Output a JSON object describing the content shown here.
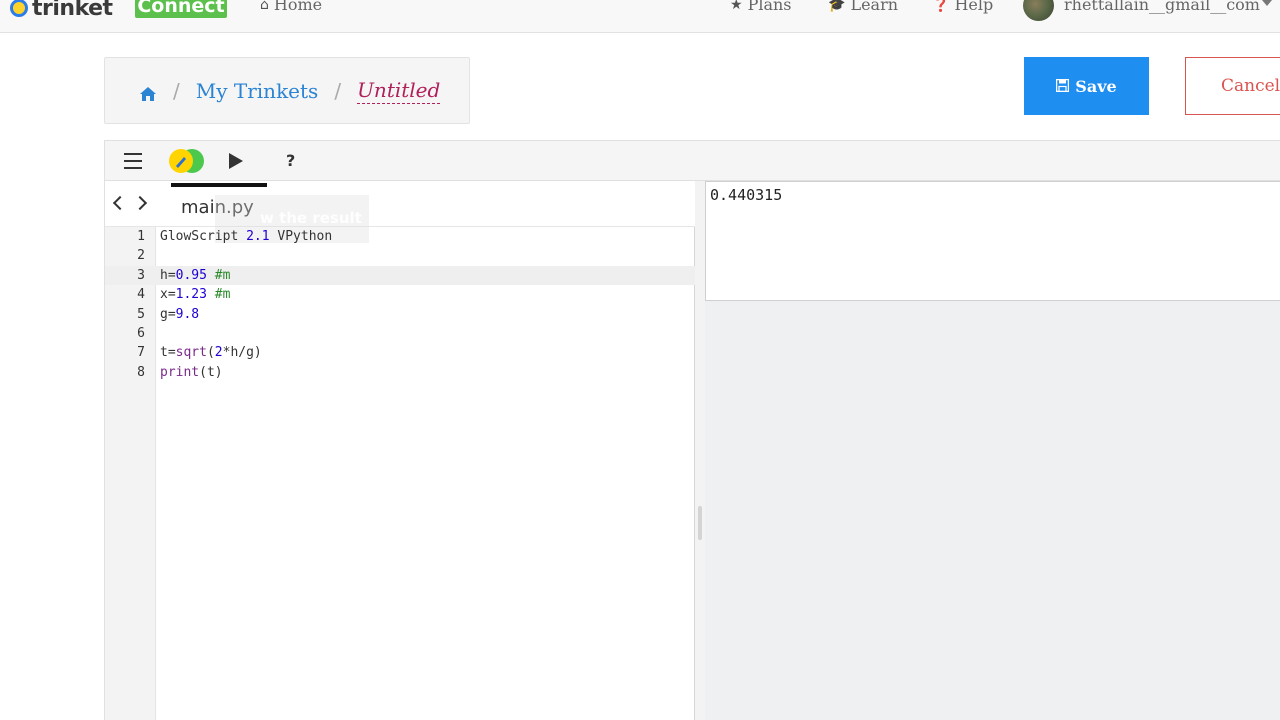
{
  "nav": {
    "logo_text": "trinket",
    "badge_text": "Connect",
    "home_label": "Home",
    "plans_label": "Plans",
    "learn_label": "Learn",
    "help_label": "Help",
    "username": "rhettallain__gmail__com"
  },
  "breadcrumb": {
    "parent_label": "My Trinkets",
    "current_label": "Untitled"
  },
  "actions": {
    "save_label": "Save",
    "cancel_label": "Cancel"
  },
  "toolbar": {
    "help_label": "?"
  },
  "editor": {
    "active_file": "main.py",
    "tooltip_text": "w the result",
    "active_line": 3,
    "lines": [
      {
        "n": "1",
        "text": "GlowScript 2.1 VPython"
      },
      {
        "n": "2",
        "text": ""
      },
      {
        "n": "3",
        "text": "h=0.95 #m"
      },
      {
        "n": "4",
        "text": "x=1.23 #m"
      },
      {
        "n": "5",
        "text": "g=9.8"
      },
      {
        "n": "6",
        "text": ""
      },
      {
        "n": "7",
        "text": "t=sqrt(2*h/g)"
      },
      {
        "n": "8",
        "text": "print(t)"
      }
    ]
  },
  "output": {
    "text": "0.440315"
  },
  "colors": {
    "primary": "#1f8ef1",
    "danger": "#d9534f",
    "badge": "#5cc04c",
    "link": "#2b83d4",
    "current": "#b0205a"
  }
}
